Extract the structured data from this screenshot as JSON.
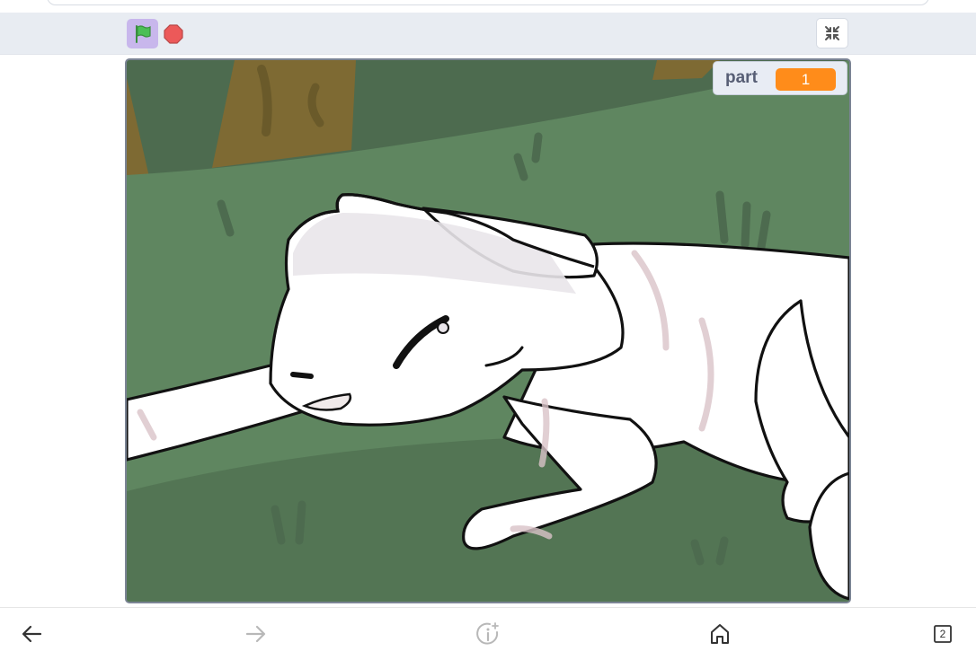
{
  "toolbar": {
    "green_flag_icon": "green-flag-icon",
    "stop_icon": "stop-icon",
    "fullscreen_exit_icon": "fullscreen-exit-icon",
    "colors": {
      "flag_bg": "#c8b7ec",
      "flag": "#4cbf56",
      "stop": "#ec5959"
    }
  },
  "stage": {
    "variable_monitor": {
      "label": "part",
      "value": "1",
      "value_color": "#ff8c1a"
    }
  },
  "browser_nav": {
    "back_icon": "arrow-left-icon",
    "forward_icon": "arrow-right-icon",
    "info_icon": "info-sparkle-icon",
    "home_icon": "home-icon",
    "tabs_count": "2"
  }
}
